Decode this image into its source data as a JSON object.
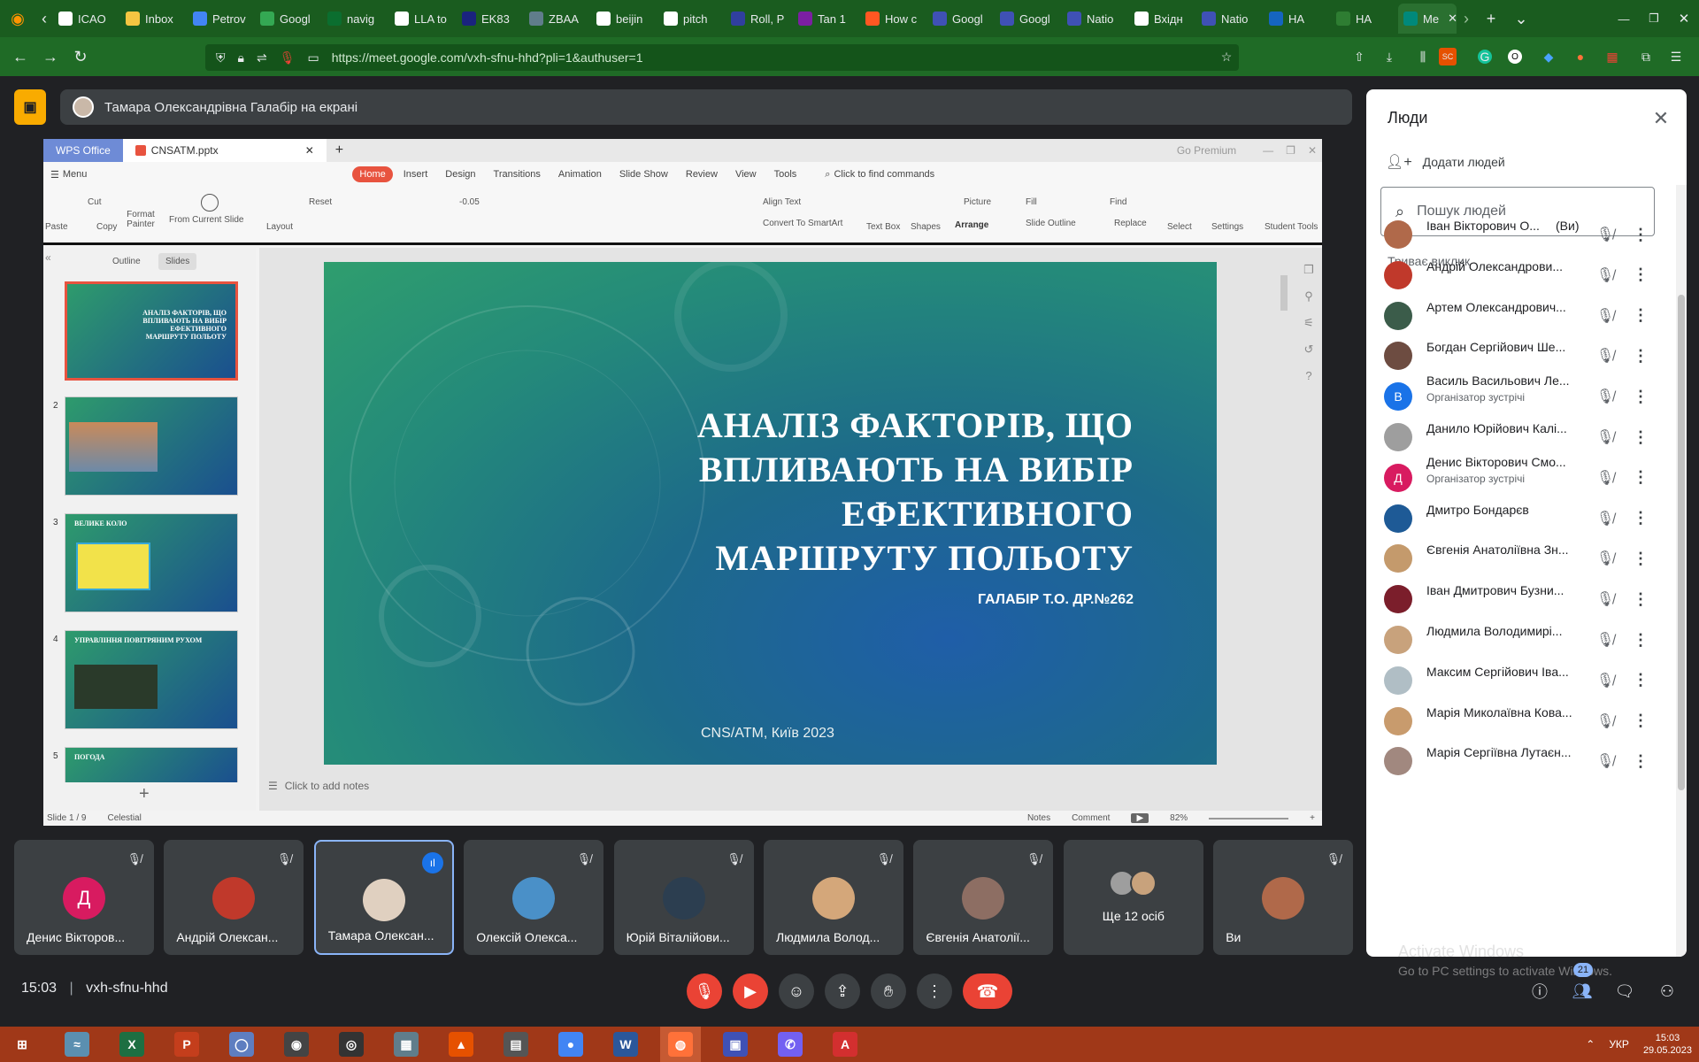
{
  "browser": {
    "tabs": [
      {
        "label": "ICAO",
        "color": "#ffffff"
      },
      {
        "label": "Inbox",
        "color": "#f4c542"
      },
      {
        "label": "Petrov",
        "color": "#4285f4"
      },
      {
        "label": "Googl",
        "color": "#34a853"
      },
      {
        "label": "navig",
        "color": "#0b6e2f"
      },
      {
        "label": "LLA to",
        "color": "#ffffff"
      },
      {
        "label": "EK83",
        "color": "#1a237e"
      },
      {
        "label": "ZBAA",
        "color": "#607d8b"
      },
      {
        "label": "beijin",
        "color": "#ffffff"
      },
      {
        "label": "pitch",
        "color": "#ffffff"
      },
      {
        "label": "Roll, P",
        "color": "#303f9f"
      },
      {
        "label": "Tan 1",
        "color": "#7b1fa2"
      },
      {
        "label": "How c",
        "color": "#ff5722"
      },
      {
        "label": "Googl",
        "color": "#3f51b5"
      },
      {
        "label": "Googl",
        "color": "#3f51b5"
      },
      {
        "label": "Natio",
        "color": "#3f51b5"
      },
      {
        "label": "Вхідн",
        "color": "#ffffff"
      },
      {
        "label": "Natio",
        "color": "#3f51b5"
      },
      {
        "label": "НА",
        "color": "#1565c0"
      },
      {
        "label": "НА",
        "color": "#2e7d32"
      }
    ],
    "active_tab": "Me",
    "url": "https://meet.google.com/vxh-sfnu-hhd?pli=1&authuser=1"
  },
  "meet": {
    "presenter_text": "Тамара Олександрівна Галабір на екрані",
    "meeting_time": "15:03",
    "meeting_code": "vxh-sfnu-hhd",
    "participants_badge": "21"
  },
  "wps": {
    "app_tab": "WPS Office",
    "doc_tab": "CNSATM.pptx",
    "premium": "Go Premium",
    "menu_label": "Menu",
    "menu_tabs": [
      "Home",
      "Insert",
      "Design",
      "Transitions",
      "Animation",
      "Slide Show",
      "Review",
      "View",
      "Tools"
    ],
    "search_commands": "Click to find commands",
    "ribbon": {
      "paste": "Paste",
      "cut": "Cut",
      "copy": "Copy",
      "format_painter": "Format Painter",
      "from_current_slide": "From Current Slide",
      "layout": "Layout",
      "reset": "Reset",
      "font_size": "-0.05",
      "align_text": "Align Text",
      "convert_smartart": "Convert To SmartArt",
      "text_box": "Text Box",
      "shapes": "Shapes",
      "picture": "Picture",
      "arrange": "Arrange",
      "fill": "Fill",
      "slide_outline": "Slide Outline",
      "find": "Find",
      "replace": "Replace",
      "select": "Select",
      "settings": "Settings",
      "student_tools": "Student Tools"
    },
    "panel_tabs": [
      "Outline",
      "Slides"
    ],
    "thumbnails": [
      {
        "num": "",
        "title": "АНАЛІЗ ФАКТОРІВ, ЩО ВПЛИВАЮТЬ НА ВИБІР ЕФЕКТИВНОГО МАРШРУТУ ПОЛЬОТУ"
      },
      {
        "num": "2",
        "title": ""
      },
      {
        "num": "3",
        "title": "ВЕЛИКЕ КОЛО"
      },
      {
        "num": "4",
        "title": "УПРАВЛІННЯ ПОВІТРЯНИМ РУХОМ"
      },
      {
        "num": "5",
        "title": "ПОГОДА"
      }
    ],
    "slide": {
      "title": "АНАЛІЗ ФАКТОРІВ, ЩО ВПЛИВАЮТЬ НА ВИБІР ЕФЕКТИВНОГО МАРШРУТУ ПОЛЬОТУ",
      "author": "ГАЛАБІР Т.О. ДР.№262",
      "footer": "CNS/ATM, Київ 2023"
    },
    "notes_placeholder": "Click to add notes",
    "status": {
      "slide_index": "Slide 1 / 9",
      "theme": "Celestial",
      "notes": "Notes",
      "comment": "Comment",
      "zoom": "82%"
    }
  },
  "people_panel": {
    "title": "Люди",
    "add_people": "Додати людей",
    "search_placeholder": "Пошук людей",
    "section_label": "Триває виклик",
    "you_suffix": "(Ви)",
    "people": [
      {
        "name": "Іван Вікторович О...",
        "role": "",
        "you": true,
        "avatar": "photo",
        "color": "#b0694a"
      },
      {
        "name": "Андрій Олександрови...",
        "role": "",
        "you": false,
        "avatar": "photo",
        "color": "#c0392b"
      },
      {
        "name": "Артем Олександрович...",
        "role": "",
        "you": false,
        "avatar": "photo",
        "color": "#3b5c4a"
      },
      {
        "name": "Богдан Сергійович Ше...",
        "role": "",
        "you": false,
        "avatar": "photo",
        "color": "#6d4c41"
      },
      {
        "name": "Василь Васильович Ле...",
        "role": "Організатор зустрічі",
        "you": false,
        "avatar": "В",
        "color": "#1a73e8"
      },
      {
        "name": "Данило Юрійович Калі...",
        "role": "",
        "you": false,
        "avatar": "photo",
        "color": "#9e9e9e"
      },
      {
        "name": "Денис Вікторович Смо...",
        "role": "Організатор зустрічі",
        "you": false,
        "avatar": "Д",
        "color": "#d81b60"
      },
      {
        "name": "Дмитро Бондарєв",
        "role": "",
        "you": false,
        "avatar": "photo",
        "color": "#1e5a96"
      },
      {
        "name": "Євгенія Анатоліївна Зн...",
        "role": "",
        "you": false,
        "avatar": "photo",
        "color": "#c49a6c"
      },
      {
        "name": "Іван Дмитрович Бузни...",
        "role": "",
        "you": false,
        "avatar": "photo",
        "color": "#7b1e2b"
      },
      {
        "name": "Людмила Володимирі...",
        "role": "",
        "you": false,
        "avatar": "photo",
        "color": "#c8a27c"
      },
      {
        "name": "Максим Сергійович Іва...",
        "role": "",
        "you": false,
        "avatar": "photo",
        "color": "#b0bec5"
      },
      {
        "name": "Марія Миколаївна Кова...",
        "role": "",
        "you": false,
        "avatar": "photo",
        "color": "#c89b6d"
      },
      {
        "name": "Марія Сергіївна Лутаєн...",
        "role": "",
        "you": false,
        "avatar": "photo",
        "color": "#a1887f"
      }
    ]
  },
  "tiles": [
    {
      "name": "Денис Вікторов...",
      "avatar": "Д",
      "color": "#d81b60",
      "selected": false
    },
    {
      "name": "Андрій Олексан...",
      "avatar": "photo",
      "color": "#c0392b",
      "selected": false
    },
    {
      "name": "Тамара Олексан...",
      "avatar": "photo",
      "color": "#e0d0c0",
      "selected": true
    },
    {
      "name": "Олексій Олекса...",
      "avatar": "photo",
      "color": "#4a90c8",
      "selected": false
    },
    {
      "name": "Юрій Віталійови...",
      "avatar": "photo",
      "color": "#2c3e50",
      "selected": false
    },
    {
      "name": "Людмила Волод...",
      "avatar": "photo",
      "color": "#d4a77a",
      "selected": false
    },
    {
      "name": "Євгенія Анатолії...",
      "avatar": "photo",
      "color": "#8d6e63",
      "selected": false
    },
    {
      "name": "Ще 12 осіб",
      "avatar": "group",
      "color": "#9e9e9e",
      "selected": false
    },
    {
      "name": "Ви",
      "avatar": "photo",
      "color": "#b0694a",
      "selected": false
    }
  ],
  "watermark": {
    "line1": "Activate Windows",
    "line2": "Go to PC settings to activate Windows."
  },
  "taskbar": {
    "apps": [
      {
        "name": "Start",
        "color": "#ffffff",
        "glyph": "⊞"
      },
      {
        "name": "Network",
        "color": "#5b8fb0",
        "glyph": "≈"
      },
      {
        "name": "Excel",
        "color": "#1d6f42",
        "glyph": "X"
      },
      {
        "name": "PowerPoint",
        "color": "#c43e1c",
        "glyph": "P"
      },
      {
        "name": "Meet",
        "color": "#5e7ec0",
        "glyph": "◯"
      },
      {
        "name": "Camera",
        "color": "#444",
        "glyph": "◉"
      },
      {
        "name": "OBS",
        "color": "#333",
        "glyph": "◎"
      },
      {
        "name": "Calculator",
        "color": "#607d8b",
        "glyph": "▦"
      },
      {
        "name": "MATLAB",
        "color": "#e65100",
        "glyph": "▲"
      },
      {
        "name": "Scanner",
        "color": "#555",
        "glyph": "▤"
      },
      {
        "name": "Chrome",
        "color": "#4285f4",
        "glyph": "●"
      },
      {
        "name": "Word",
        "color": "#2b579a",
        "glyph": "W"
      },
      {
        "name": "Firefox",
        "color": "#ff7139",
        "glyph": "◍"
      },
      {
        "name": "Save",
        "color": "#3f51b5",
        "glyph": "▣"
      },
      {
        "name": "Viber",
        "color": "#7360f2",
        "glyph": "✆"
      },
      {
        "name": "Acrobat",
        "color": "#d32f2f",
        "glyph": "A"
      }
    ],
    "lang": "УКР",
    "time": "15:03",
    "date": "29.05.2023"
  }
}
